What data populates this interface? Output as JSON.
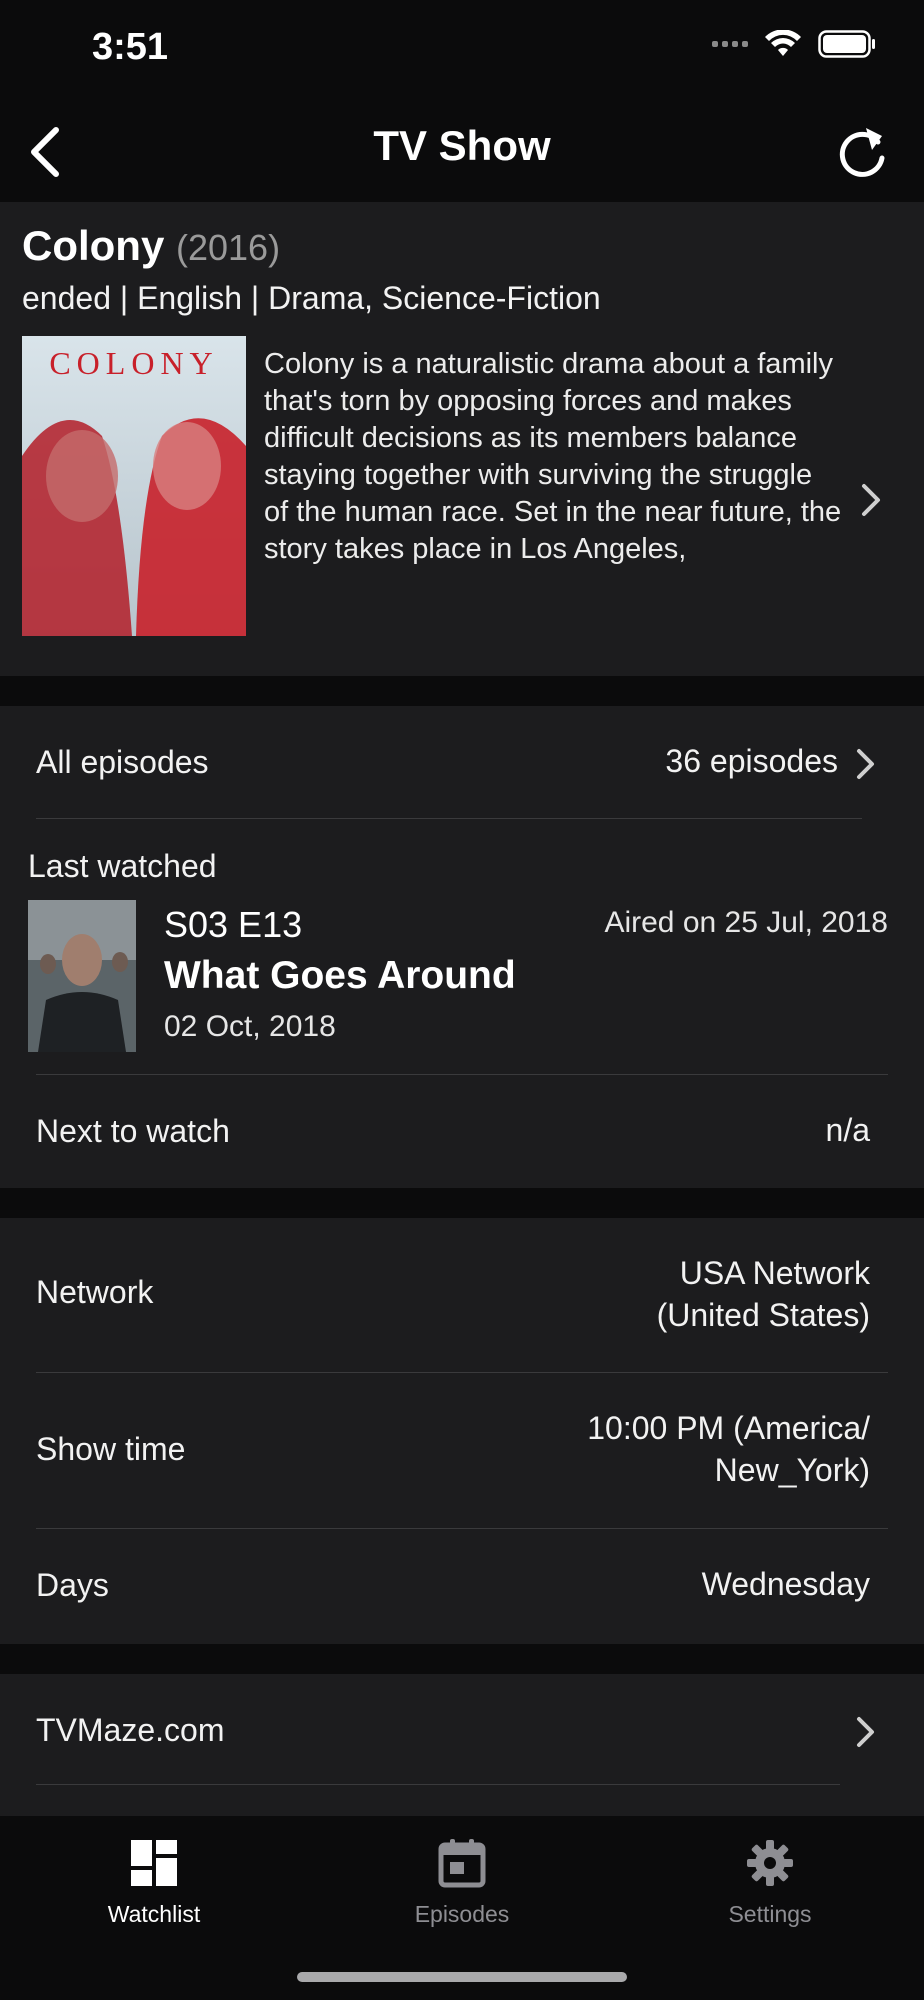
{
  "status_bar": {
    "time": "3:51"
  },
  "nav": {
    "title": "TV Show",
    "back_icon": "chevron-left-icon",
    "refresh_icon": "refresh-icon"
  },
  "show": {
    "title": "Colony",
    "year": "(2016)",
    "meta": "ended | English | Drama, Science-Fiction",
    "poster_text": "COLONY",
    "summary": "Colony is a naturalistic drama about a family that's torn by opposing forces and makes difficult decisions as its members balance staying together with surviving the struggle of the human race. Set in the near future, the story takes place in Los Angeles,"
  },
  "episodes_section": {
    "all_episodes_label": "All episodes",
    "all_episodes_value": "36 episodes",
    "last_watched_label": "Last watched",
    "last_episode": {
      "code": "S03 E13",
      "aired": "Aired on 25 Jul, 2018",
      "title": "What Goes Around",
      "watched_date": "02 Oct, 2018"
    },
    "next_label": "Next to watch",
    "next_value": "n/a"
  },
  "info_section": {
    "network_label": "Network",
    "network_value_line1": "USA Network",
    "network_value_line2": "(United States)",
    "showtime_label": "Show time",
    "showtime_value_line1": "10:00 PM (America/",
    "showtime_value_line2": "New_York)",
    "days_label": "Days",
    "days_value": "Wednesday"
  },
  "links_section": {
    "tvmaze_label": "TVMaze.com"
  },
  "tab_bar": {
    "tabs": [
      {
        "label": "Watchlist",
        "icon": "grid-icon",
        "active": true
      },
      {
        "label": "Episodes",
        "icon": "calendar-icon",
        "active": false
      },
      {
        "label": "Settings",
        "icon": "gear-icon",
        "active": false
      }
    ]
  },
  "colors": {
    "background": "#0b0b0c",
    "surface": "#1c1c1e",
    "inactive_tab": "#8e8e93",
    "poster_red": "#c8202a"
  }
}
